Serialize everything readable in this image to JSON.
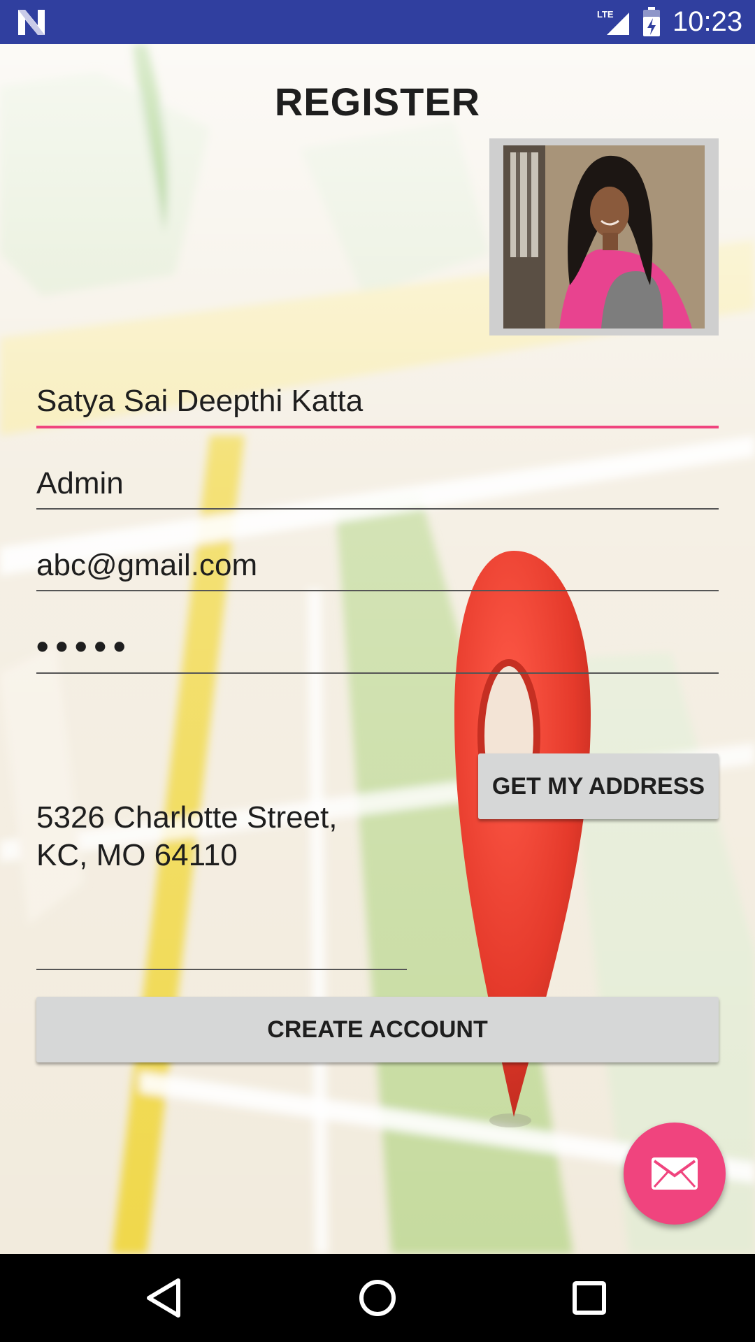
{
  "status_bar": {
    "time": "10:23",
    "network": "LTE",
    "icons": [
      "notification-n-icon",
      "lte-signal-icon",
      "battery-charging-icon"
    ]
  },
  "screen": {
    "title": "REGISTER",
    "profile_photo": "person-photo"
  },
  "form": {
    "name_value": "Satya Sai Deepthi Katta",
    "role_value": "Admin",
    "email_value": "abc@gmail.com",
    "password_value": "•••••",
    "address_value": "5326 Charlotte Street,\nKC, MO 64110"
  },
  "buttons": {
    "get_address": "GET MY ADDRESS",
    "create_account": "CREATE ACCOUNT",
    "fab_icon": "mail-icon"
  },
  "nav": {
    "icons": [
      "back-icon",
      "home-icon",
      "recents-icon"
    ]
  },
  "colors": {
    "status_bar": "#303F9F",
    "accent": "#F0447E",
    "button": "#d6d7d7"
  }
}
